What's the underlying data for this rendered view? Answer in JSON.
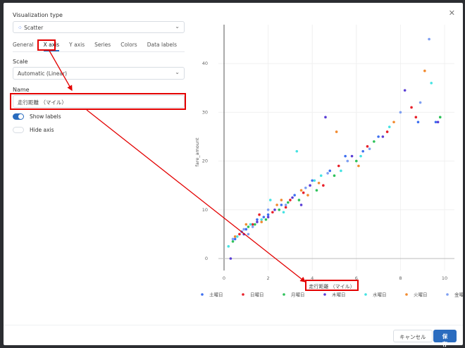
{
  "dialog": {
    "close_icon": "close-icon"
  },
  "viz": {
    "label": "Visualization type",
    "value": "Scatter"
  },
  "tabs": [
    "General",
    "X axis",
    "Y axis",
    "Series",
    "Colors",
    "Data labels"
  ],
  "active_tab": 1,
  "scale": {
    "label": "Scale",
    "value": "Automatic (Linear)"
  },
  "name": {
    "label": "Name",
    "value": "走行距離 （マイル）"
  },
  "show_labels": {
    "label": "Show labels",
    "on": true
  },
  "hide_axis": {
    "label": "Hide axis",
    "on": false
  },
  "footer": {
    "cancel": "キャンセル",
    "save": "保 存"
  },
  "chart_data": {
    "type": "scatter",
    "xlabel": "走行距離 （マイル）",
    "ylabel": "fare_amount",
    "xlim": [
      -0.3,
      10.5
    ],
    "ylim": [
      -1,
      46
    ],
    "xticks": [
      0,
      2,
      4,
      6,
      8,
      10
    ],
    "yticks": [
      0,
      10,
      20,
      30,
      40
    ],
    "grid": true,
    "legend": "bottom",
    "series": [
      {
        "name": "土曜日",
        "color": "#3d6ff0",
        "points": [
          [
            0.5,
            4
          ],
          [
            1,
            6
          ],
          [
            1.5,
            8
          ],
          [
            2,
            9
          ],
          [
            2.6,
            11
          ],
          [
            3.2,
            13
          ],
          [
            4,
            16
          ],
          [
            4.8,
            18
          ],
          [
            5.5,
            21
          ],
          [
            6.3,
            22
          ],
          [
            7,
            25
          ],
          [
            8.8,
            28
          ],
          [
            9.6,
            28
          ],
          [
            0.8,
            5.5
          ],
          [
            1.8,
            8.5
          ]
        ]
      },
      {
        "name": "日曜日",
        "color": "#e8202a",
        "points": [
          [
            0.7,
            5
          ],
          [
            1.3,
            7
          ],
          [
            2.2,
            9.5
          ],
          [
            3,
            12
          ],
          [
            3.6,
            13.5
          ],
          [
            4.5,
            15
          ],
          [
            5.2,
            19
          ],
          [
            6.5,
            23
          ],
          [
            7.4,
            26
          ],
          [
            8.5,
            31
          ],
          [
            8.7,
            29
          ],
          [
            1.6,
            9
          ],
          [
            2.8,
            10.5
          ]
        ]
      },
      {
        "name": "月曜日",
        "color": "#2ec25a",
        "points": [
          [
            0.4,
            3.5
          ],
          [
            1.1,
            6.5
          ],
          [
            1.9,
            8
          ],
          [
            2.5,
            10
          ],
          [
            3.4,
            12
          ],
          [
            4.2,
            14
          ],
          [
            5,
            17
          ],
          [
            6,
            20
          ],
          [
            6.8,
            24
          ],
          [
            9.8,
            29
          ],
          [
            1.4,
            7
          ],
          [
            2.9,
            11.5
          ]
        ]
      },
      {
        "name": "木曜日",
        "color": "#5a3ed6",
        "points": [
          [
            0.3,
            0
          ],
          [
            0.9,
            5
          ],
          [
            1.5,
            7.5
          ],
          [
            2.3,
            10
          ],
          [
            3.1,
            12.5
          ],
          [
            3.9,
            15
          ],
          [
            4.6,
            29
          ],
          [
            5.8,
            21
          ],
          [
            7.2,
            25
          ],
          [
            8.2,
            34.5
          ],
          [
            9.7,
            28
          ],
          [
            2,
            8.5
          ],
          [
            3.5,
            11
          ]
        ]
      },
      {
        "name": "水曜日",
        "color": "#45e3e3",
        "points": [
          [
            0.2,
            2.5
          ],
          [
            0.6,
            4.5
          ],
          [
            1.2,
            7
          ],
          [
            2.1,
            12
          ],
          [
            2.7,
            9.5
          ],
          [
            3.3,
            22
          ],
          [
            4.1,
            16
          ],
          [
            5.3,
            18
          ],
          [
            6.2,
            21
          ],
          [
            7.5,
            27
          ],
          [
            9.4,
            36
          ],
          [
            1.7,
            8
          ],
          [
            4.4,
            17
          ]
        ]
      },
      {
        "name": "火曜日",
        "color": "#f28b30",
        "points": [
          [
            0.5,
            4.5
          ],
          [
            1,
            7
          ],
          [
            1.7,
            7.5
          ],
          [
            2.4,
            11
          ],
          [
            3.5,
            14
          ],
          [
            4.3,
            15.5
          ],
          [
            5.1,
            26
          ],
          [
            6.1,
            19
          ],
          [
            7.7,
            28
          ],
          [
            9.1,
            38.5
          ],
          [
            2.6,
            12
          ],
          [
            3.8,
            13
          ]
        ]
      },
      {
        "name": "金曜日",
        "color": "#7e9ff2",
        "points": [
          [
            0.4,
            4
          ],
          [
            0.9,
            6
          ],
          [
            1.3,
            6.5
          ],
          [
            2,
            10
          ],
          [
            2.8,
            11
          ],
          [
            3.7,
            14.5
          ],
          [
            4.7,
            17.5
          ],
          [
            5.6,
            20
          ],
          [
            6.6,
            22.5
          ],
          [
            8,
            30
          ],
          [
            9.3,
            45
          ],
          [
            8.9,
            32
          ],
          [
            1.1,
            5
          ]
        ]
      }
    ]
  }
}
